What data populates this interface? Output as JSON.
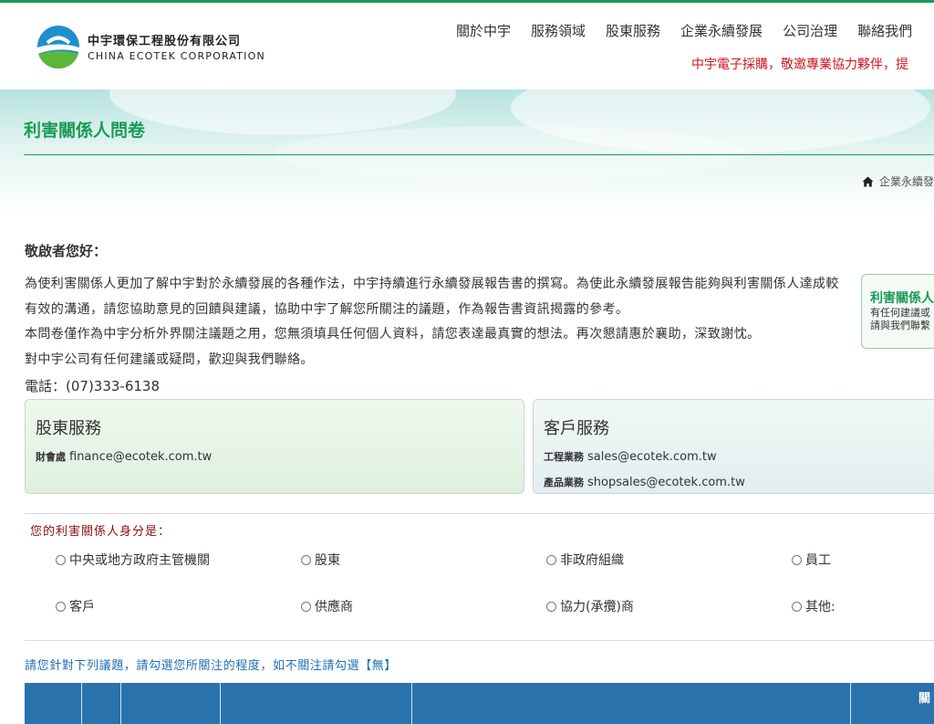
{
  "header": {
    "logo_zh": "中宇環保工程股份有限公司",
    "logo_en": "CHINA ECOTEK CORPORATION",
    "nav": [
      "關於中宇",
      "服務領域",
      "股東服務",
      "企業永續發展",
      "公司治理",
      "聯絡我們"
    ],
    "marquee": "中宇電子採購，敬邀專業協力夥伴，提"
  },
  "banner": {
    "title": "利害關係人問卷",
    "breadcrumb": "企業永續發"
  },
  "intro": {
    "greeting": "敬啟者您好：",
    "paragraphs": [
      "為使利害關係人更加了解中宇對於永續發展的各種作法，中宇持續進行永續發展報告書的撰寫。為使此永續發展報告能夠與利害關係人達成較有效的溝通，請您協助意見的回饋與建議，協助中宇了解您所關注的議題，作為報告書資訊揭露的參考。",
      "本問卷僅作為中宇分析外界關注議題之用，您無須填具任何個人資料，請您表達最真實的想法。再次懇請惠於襄助，深致謝忱。",
      "對中宇公司有任何建議或疑問，歡迎與我們聯絡。"
    ],
    "phone": "電話：(07)333-6138"
  },
  "side_box": {
    "title": "利害關係人",
    "line1": "有任何建議或",
    "line2": "請與我們聯繫"
  },
  "cards": {
    "shareholder": {
      "title": "股東服務",
      "label": "財會處",
      "email": "finance@ecotek.com.tw"
    },
    "customer": {
      "title": "客戶服務",
      "line1_label": "工程業務",
      "line1_email": "sales@ecotek.com.tw",
      "line2_label": "產品業務",
      "line2_email": "shopsales@ecotek.com.tw"
    }
  },
  "identity": {
    "label": "您的利害關係人身分是：",
    "options": [
      "中央或地方政府主管機關",
      "股東",
      "非政府組織",
      "員工",
      "客戶",
      "供應商",
      "協力(承攬)商",
      "其他:"
    ]
  },
  "instruction": "請您針對下列議題，請勾選您所關注的程度，如不關注請勾選【無】",
  "table": {
    "header_text": "關"
  },
  "colors": {
    "brand_green": "#1c9a57",
    "table_blue": "#2a72ac",
    "marquee_red": "#d0141c",
    "link_blue": "#1f6fb6"
  }
}
